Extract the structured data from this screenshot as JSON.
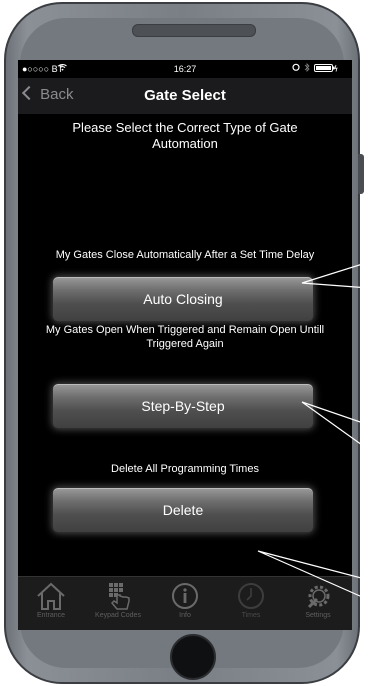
{
  "status_bar": {
    "carrier": "●○○○○ BT",
    "time": "16:27"
  },
  "nav": {
    "back_label": "Back",
    "title": "Gate Select"
  },
  "instruction": "Please Select the Correct Type of Gate Automation",
  "options": [
    {
      "description": "My Gates Close Automatically After a Set Time Delay",
      "button_label": "Auto Closing"
    },
    {
      "description": "My Gates Open When Triggered and Remain Open Untill Triggered Again",
      "button_label": "Step-By-Step"
    },
    {
      "description": "Delete All Programming Times",
      "button_label": "Delete"
    }
  ],
  "tab_bar": [
    {
      "label": "Entrance",
      "icon": "house-icon"
    },
    {
      "label": "Keypad Codes",
      "icon": "keypad-hand-icon"
    },
    {
      "label": "Info",
      "icon": "info-icon"
    },
    {
      "label": "Times",
      "icon": "clock-icon"
    },
    {
      "label": "Settings",
      "icon": "gear-wrench-icon"
    }
  ],
  "colors": {
    "screen_bg": "#000000",
    "nav_bg": "#1b1b1d",
    "button_gradient_top": "#9a9a9a",
    "button_gradient_bottom": "#404040",
    "tab_label": "#5f5f5f",
    "phone_body": "#7a7f85"
  }
}
